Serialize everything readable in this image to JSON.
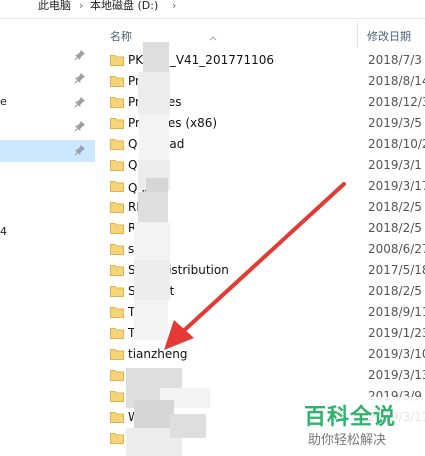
{
  "breadcrumb": {
    "items": [
      "此电脑",
      "本地磁盘 (D:)"
    ],
    "separator": "›"
  },
  "nav": {
    "rows": [
      {
        "text": "",
        "pinned": true
      },
      {
        "text": "",
        "pinned": true
      },
      {
        "text": "e",
        "pinned": true
      },
      {
        "text": "",
        "pinned": true
      },
      {
        "text": "",
        "pinned": true,
        "selected": true
      },
      {
        "text": "",
        "pinned": false
      },
      {
        "text": "",
        "pinned": false
      },
      {
        "text": "4",
        "pinned": false
      }
    ]
  },
  "columns": {
    "name": "名称",
    "date": "修改日期"
  },
  "files": [
    {
      "name": "PK      010_V41_201771106",
      "date": "2018/7/3"
    },
    {
      "name": "Pr         n",
      "date": "2018/8/14"
    },
    {
      "name": "Pr         n Files",
      "date": "2018/12/3"
    },
    {
      "name": "Pr         n Files (x86)",
      "date": "2019/3/5"
    },
    {
      "name": "Q          wnload",
      "date": "2018/10/2"
    },
    {
      "name": "Q          Mgr",
      "date": "2019/3/1"
    },
    {
      "name": "Q          器",
      "date": "2019/3/17"
    },
    {
      "name": "RI",
      "date": "2018/2/5"
    },
    {
      "name": "R         3",
      "date": "2018/2/5"
    },
    {
      "name": "sı",
      "date": "2008/6/27"
    },
    {
      "name": "So         reDistribution",
      "date": "2017/5/18"
    },
    {
      "name": "So         nput",
      "date": "2018/2/5"
    },
    {
      "name": "Th         re",
      "date": "2018/9/11"
    },
    {
      "name": "Th",
      "date": "2019/1/23"
    },
    {
      "name": "tianzheng",
      "date": "2019/3/10"
    },
    {
      "name": "W         A",
      "date": "2019/3/13"
    },
    {
      "name": "",
      "date": "2019/3/9"
    },
    {
      "name": "W               Cache",
      "date": "2019/3/11"
    },
    {
      "name": "",
      "date": ""
    }
  ],
  "watermark": {
    "title": "百科全说",
    "subtitle": "助你轻松解决"
  },
  "colors": {
    "folder": "#f5d47a",
    "folder_dark": "#e0b44a",
    "arrow": "#e53935",
    "selection": "#cce8ff",
    "watermark_green": "#2db36b"
  }
}
